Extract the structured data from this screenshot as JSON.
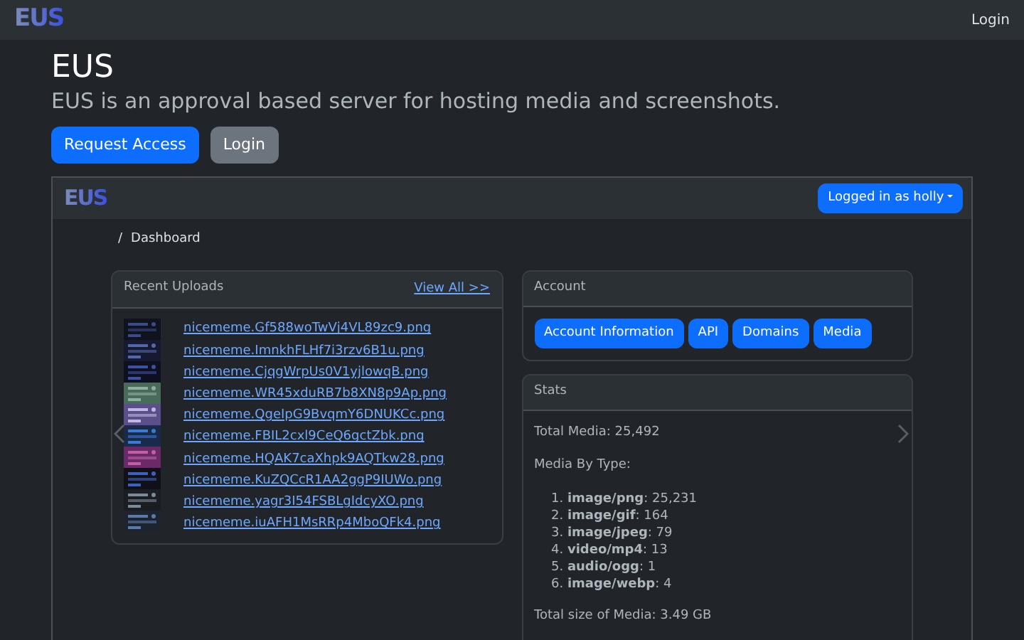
{
  "navbar": {
    "brand": "EUS",
    "links": [
      "Login"
    ]
  },
  "hero": {
    "title": "EUS",
    "lead": "EUS is an approval based server for hosting media and screenshots.",
    "buttons": [
      {
        "label": "Request Access",
        "kind": "primary"
      },
      {
        "label": "Login",
        "kind": "secondary"
      }
    ]
  },
  "preview": {
    "navbar": {
      "brand": "EUS",
      "user_menu": "Logged in as holly"
    },
    "breadcrumb": [
      {
        "divider": "/",
        "label": "Dashboard"
      }
    ],
    "recent_uploads": {
      "title": "Recent Uploads",
      "view_all": "View All >>",
      "files": [
        {
          "name": "nicememe.Gf588woTwVj4VL89zc9.png"
        },
        {
          "name": "nicememe.ImnkhFLHf7i3rzv6B1u.png"
        },
        {
          "name": "nicememe.CjqgWrpUs0V1yjlowqB.png"
        },
        {
          "name": "nicememe.WR45xduRB7b8XN8p9Ap.png"
        },
        {
          "name": "nicememe.QgeIpG9BvqmY6DNUKCc.png"
        },
        {
          "name": "nicememe.FBIL2cxl9CeQ6gctZbk.png"
        },
        {
          "name": "nicememe.HQAK7caXhpk9AQTkw28.png"
        },
        {
          "name": "nicememe.KuZQCcR1AA2ggP9IUWo.png"
        },
        {
          "name": "nicememe.yagr3I54FSBLgIdcyXO.png"
        },
        {
          "name": "nicememe.iuAFH1MsRRp4MboQFk4.png"
        }
      ]
    },
    "account": {
      "title": "Account",
      "buttons": [
        "Account Information",
        "API",
        "Domains",
        "Media"
      ]
    },
    "stats": {
      "title": "Stats",
      "total": "Total Media: 25,492",
      "by_type_label": "Media By Type:",
      "types": [
        "1. **image/png**: 25,231",
        "2. **image/gif**: 164",
        "3. **image/jpeg**: 79",
        "4. **video/mp4**: 13",
        "5. **audio/ogg**: 1",
        "6. **image/webp**: 4"
      ],
      "total_size": "Total size of Media: 3.49 GB"
    }
  }
}
